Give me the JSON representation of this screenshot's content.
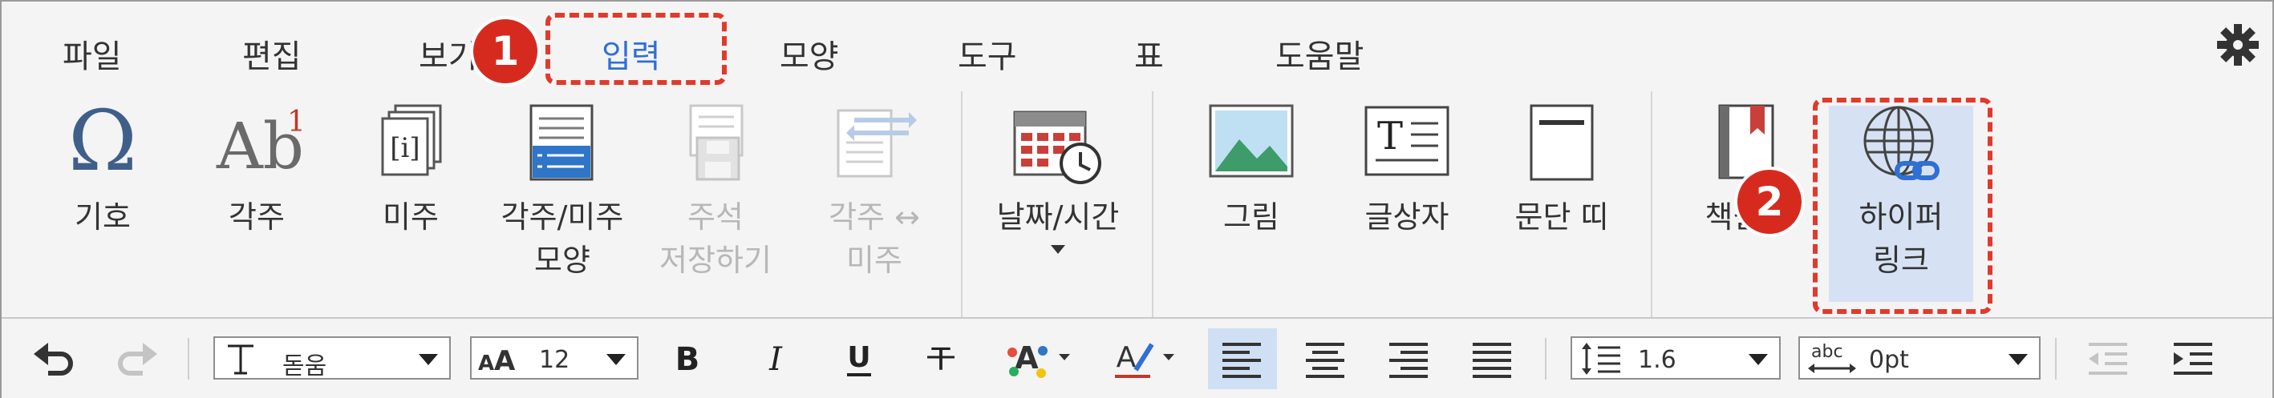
{
  "menubar": {
    "items": [
      "파일",
      "편집",
      "보기",
      "입력",
      "모양",
      "도구",
      "표",
      "도움말"
    ],
    "active": "입력"
  },
  "ribbon": {
    "buttons": [
      {
        "label": "기호",
        "icon": "omega-icon",
        "disabled": false
      },
      {
        "label": "각주",
        "icon": "footnote-icon",
        "disabled": false
      },
      {
        "label": "미주",
        "icon": "endnote-icon",
        "disabled": false
      },
      {
        "label": "각주/미주\n모양",
        "icon": "note-style-icon",
        "disabled": false
      },
      {
        "label": "주석\n저장하기",
        "icon": "save-note-icon",
        "disabled": true
      },
      {
        "label": "각주 ↔\n미주",
        "icon": "swap-note-icon",
        "disabled": true
      },
      {
        "label": "날짜/시간",
        "icon": "calendar-clock-icon",
        "disabled": false
      },
      {
        "label": "그림",
        "icon": "picture-icon",
        "disabled": false
      },
      {
        "label": "글상자",
        "icon": "textbox-icon",
        "disabled": false
      },
      {
        "label": "문단 띠",
        "icon": "paragraph-band-icon",
        "disabled": false
      },
      {
        "label": "책갈피",
        "icon": "bookmark-icon",
        "disabled": false
      },
      {
        "label": "하이퍼\n링크",
        "icon": "globe-link-icon",
        "disabled": false
      }
    ]
  },
  "toolbar": {
    "font": "돋움",
    "font_size": "12",
    "line_spacing": "1.6",
    "char_spacing": "0pt",
    "abc_label": "abc"
  },
  "annotations": {
    "badge1": "1",
    "badge2": "2"
  },
  "colors": {
    "accent": "#2f6fd6",
    "annotation": "#d72a1f",
    "highlight": "#d6e2f4"
  }
}
